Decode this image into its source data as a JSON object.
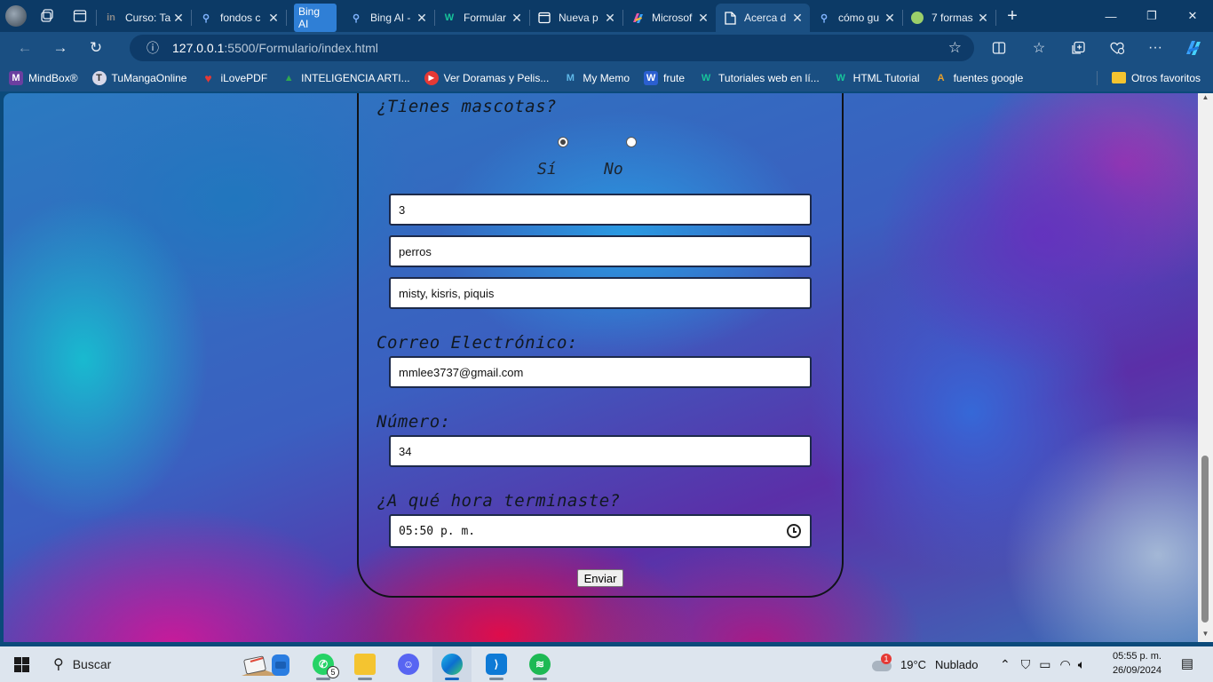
{
  "browser": {
    "tabs": [
      {
        "title": "Curso: Ta",
        "favicon": "in",
        "favicon_color": "#777777"
      },
      {
        "title": "fondos c",
        "favicon": "search-icon",
        "favicon_color": "#7fb3ff"
      },
      {
        "title": "Bing AI",
        "pill": "Bing AI"
      },
      {
        "title": "Bing AI -",
        "favicon": "search-icon",
        "favicon_color": "#7fb3ff"
      },
      {
        "title": "Formular",
        "favicon": "W",
        "favicon_color": "#17c49a"
      },
      {
        "title": "Nueva p",
        "favicon": "page-icon",
        "favicon_color": "#ffffff"
      },
      {
        "title": "Microsof",
        "favicon": "copilot-icon",
        "favicon_color": "#e85aa8"
      },
      {
        "title": "Acerca d",
        "favicon": "document-icon",
        "favicon_color": "#ffffff",
        "active": true
      },
      {
        "title": "cómo gu",
        "favicon": "search-icon",
        "favicon_color": "#7fb3ff"
      },
      {
        "title": "7 formas",
        "favicon": "chrome-icon",
        "favicon_color": "#9bcf6a"
      }
    ],
    "close_glyph": "✕",
    "url_host": "127.0.0.1",
    "url_rest": ":5500/Formulario/index.html",
    "bookmarks": [
      {
        "label": "MindBox®",
        "color": "#6b3fa0",
        "glyph": "M"
      },
      {
        "label": "TuMangaOnline",
        "color": "#d8d8e8",
        "glyph": "T"
      },
      {
        "label": "iLovePDF",
        "color": "#e53935",
        "glyph": "♥"
      },
      {
        "label": "INTELIGENCIA ARTI...",
        "color": "#2fa84f",
        "glyph": "▲"
      },
      {
        "label": "Ver Doramas y Pelis...",
        "color": "#e53935",
        "glyph": "▶"
      },
      {
        "label": "My Memo",
        "color": "#5fb8e8",
        "glyph": "M"
      },
      {
        "label": "frute",
        "color": "#2b5fd0",
        "glyph": "W"
      },
      {
        "label": "Tutoriales web en lí...",
        "color": "#17c49a",
        "glyph": "W"
      },
      {
        "label": "HTML Tutorial",
        "color": "#17c49a",
        "glyph": "W"
      },
      {
        "label": "fuentes google",
        "color": "#e8a02a",
        "glyph": "A"
      }
    ],
    "other_favorites": "Otros favoritos"
  },
  "form": {
    "pets_question": "¿Tienes mascotas?",
    "yes_label": "Sí",
    "no_label": "No",
    "selected": "yes",
    "pet_count": "3",
    "pet_type": "perros",
    "pet_names": "misty, kisris, piquis",
    "email_label": "Correo Electrónico:",
    "email": "mmlee3737@gmail.com",
    "number_label": "Número:",
    "number": "34",
    "time_label": "¿A qué hora terminaste?",
    "time": "05:50 p. m.",
    "submit": "Enviar"
  },
  "taskbar": {
    "search_placeholder": "Buscar",
    "whatsapp_badge": "5",
    "weather_badge": "1",
    "temperature": "19°C",
    "weather": "Nublado",
    "time": "05:55 p. m.",
    "date": "26/09/2024"
  }
}
